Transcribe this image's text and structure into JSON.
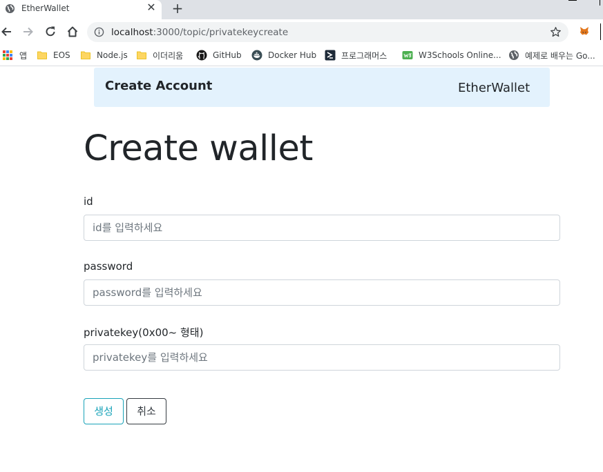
{
  "browser": {
    "tab": {
      "title": "EtherWallet"
    },
    "newtab_symbol": "+",
    "tab_close_symbol": "✕",
    "url_host": "localhost",
    "url_path": ":3000/topic/privatekeycreate",
    "bookmarks": [
      {
        "label": "앱",
        "icon": "apps-grid-icon"
      },
      {
        "label": "EOS",
        "icon": "folder-icon"
      },
      {
        "label": "Node.js",
        "icon": "folder-icon"
      },
      {
        "label": "이더리움",
        "icon": "folder-icon"
      },
      {
        "label": "GitHub",
        "icon": "github-icon"
      },
      {
        "label": "Docker Hub",
        "icon": "docker-icon"
      },
      {
        "label": "프로그래머스",
        "icon": "programmers-icon"
      },
      {
        "label": "W3Schools Online...",
        "icon": "w3schools-icon"
      },
      {
        "label": "예제로 배우는 Go...",
        "icon": "globe-icon"
      }
    ]
  },
  "navbar": {
    "brand": "Create Account",
    "link": "EtherWallet"
  },
  "main": {
    "title": "Create wallet",
    "fields": {
      "id": {
        "label": "id",
        "placeholder": "id를 입력하세요",
        "value": ""
      },
      "password": {
        "label": "password",
        "placeholder": "password를 입력하세요",
        "value": ""
      },
      "privatekey": {
        "label": "privatekey(0x00~ 형태)",
        "placeholder": "privatekey를 입력하세요",
        "value": ""
      }
    },
    "buttons": {
      "create": "생성",
      "cancel": "취소"
    }
  },
  "colors": {
    "navbar_bg": "#e3f2fd",
    "create_button": "#17a2b8",
    "cancel_button": "#343a40",
    "folder": "#fdd663"
  }
}
